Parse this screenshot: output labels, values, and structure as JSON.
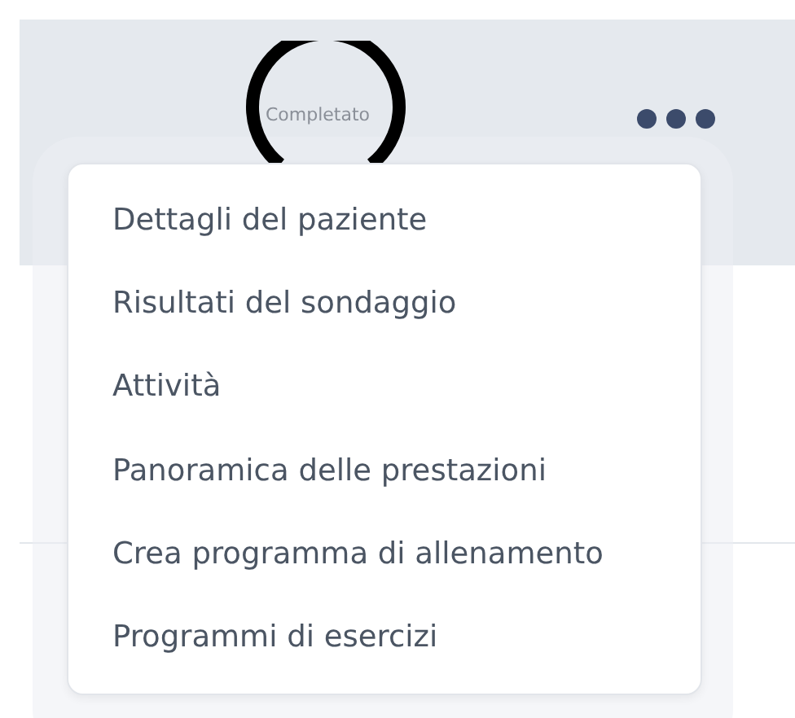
{
  "card": {
    "status": "Completato"
  },
  "menu": {
    "items": [
      {
        "label": "Dettagli del paziente"
      },
      {
        "label": "Risultati del sondaggio"
      },
      {
        "label": "Attività"
      },
      {
        "label": "Panoramica delle prestazioni"
      },
      {
        "label": "Crea programma di allenamento"
      },
      {
        "label": "Programmi di esercizi"
      }
    ]
  }
}
